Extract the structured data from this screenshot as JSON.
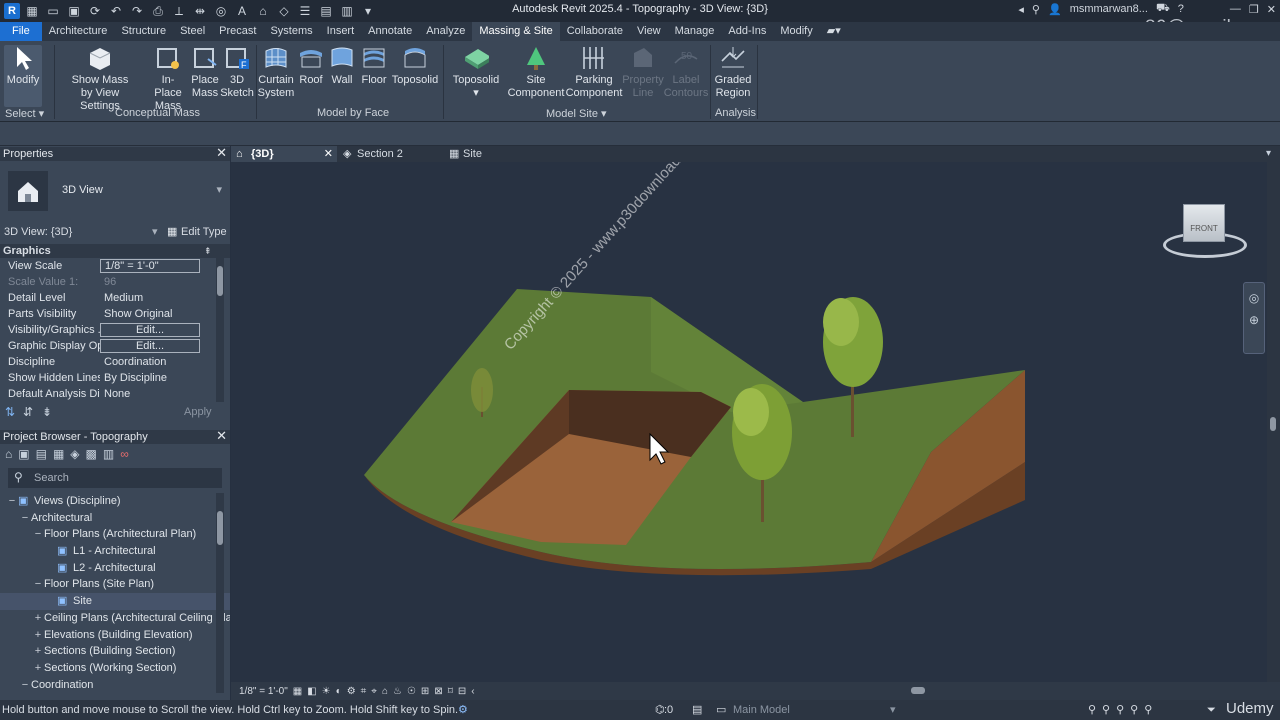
{
  "window": {
    "title": "Autodesk Revit 2025.4 - Topography - 3D View: {3D}",
    "user": "msmmarwan8...",
    "watermark_email": "msmmarwan86@gmail.com"
  },
  "ribbon_tabs": [
    "File",
    "Architecture",
    "Structure",
    "Steel",
    "Precast",
    "Systems",
    "Insert",
    "Annotate",
    "Analyze",
    "Massing & Site",
    "Collaborate",
    "View",
    "Manage",
    "Add-Ins",
    "Modify"
  ],
  "ribbon": {
    "modify": {
      "label": "Modify",
      "panel": "Select"
    },
    "conceptual_mass": {
      "panel": "Conceptual Mass",
      "show_mass_l1": "Show Mass",
      "show_mass_l2": "by View Settings",
      "inplace_l1": "In-Place",
      "inplace_l2": "Mass",
      "place_l1": "Place",
      "place_l2": "Mass",
      "sketch_l1": "3D",
      "sketch_l2": "Sketch"
    },
    "model_by_face": {
      "panel": "Model by Face",
      "curtain_l1": "Curtain",
      "curtain_l2": "System",
      "roof": "Roof",
      "wall": "Wall",
      "floor": "Floor",
      "toposolid": "Toposolid"
    },
    "model_site": {
      "panel": "Model Site",
      "toposolid": "Toposolid",
      "site_l1": "Site",
      "site_l2": "Component",
      "parking_l1": "Parking",
      "parking_l2": "Component",
      "property_l1": "Property",
      "property_l2": "Line",
      "label_l1": "Label",
      "label_l2": "Contours"
    },
    "analysis": {
      "panel": "Analysis",
      "graded_l1": "Graded",
      "graded_l2": "Region"
    }
  },
  "properties": {
    "header": "Properties",
    "type_name": "3D View",
    "instance": "3D View: {3D}",
    "edit_type": "Edit Type",
    "section": "Graphics",
    "rows": [
      {
        "k": "View Scale",
        "v": "1/8\" = 1'-0\""
      },
      {
        "k": "Scale Value    1:",
        "v": "96"
      },
      {
        "k": "Detail Level",
        "v": "Medium"
      },
      {
        "k": "Parts Visibility",
        "v": "Show Original"
      },
      {
        "k": "Visibility/Graphics ...",
        "v": "Edit..."
      },
      {
        "k": "Graphic Display Op...",
        "v": "Edit..."
      },
      {
        "k": "Discipline",
        "v": "Coordination"
      },
      {
        "k": "Show Hidden Lines",
        "v": "By Discipline"
      },
      {
        "k": "Default Analysis Dis...",
        "v": "None"
      }
    ],
    "apply": "Apply"
  },
  "project_browser": {
    "header": "Project Browser - Topography",
    "search_placeholder": "Search",
    "nodes": [
      {
        "label": "Views (Discipline)",
        "level": 0,
        "toggle": "−"
      },
      {
        "label": "Architectural",
        "level": 1,
        "toggle": "−"
      },
      {
        "label": "Floor Plans (Architectural Plan)",
        "level": 2,
        "toggle": "−"
      },
      {
        "label": "L1 - Architectural",
        "level": 3,
        "toggle": ""
      },
      {
        "label": "L2 - Architectural",
        "level": 3,
        "toggle": ""
      },
      {
        "label": "Floor Plans (Site Plan)",
        "level": 2,
        "toggle": "−"
      },
      {
        "label": "Site",
        "level": 3,
        "toggle": ""
      },
      {
        "label": "Ceiling Plans (Architectural Ceiling Pla",
        "level": 2,
        "toggle": "+"
      },
      {
        "label": "Elevations (Building Elevation)",
        "level": 2,
        "toggle": "+"
      },
      {
        "label": "Sections (Building Section)",
        "level": 2,
        "toggle": "+"
      },
      {
        "label": "Sections (Working Section)",
        "level": 2,
        "toggle": "+"
      },
      {
        "label": "Coordination",
        "level": 1,
        "toggle": "−"
      }
    ]
  },
  "view_tabs": [
    "{3D}",
    "Section 2",
    "Site"
  ],
  "viewport": {
    "viewcube_label": "FRONT",
    "copyright": "Copyright © 2025 - www.p30download.com"
  },
  "view_bar": {
    "scale": "1/8\" = 1'-0\""
  },
  "status": {
    "message": "Hold button and move mouse to Scroll the view. Hold Ctrl key to Zoom. Hold Shift key to Spin.",
    "workset_count": ":0",
    "model": "Main Model",
    "brand": "Udemy"
  }
}
